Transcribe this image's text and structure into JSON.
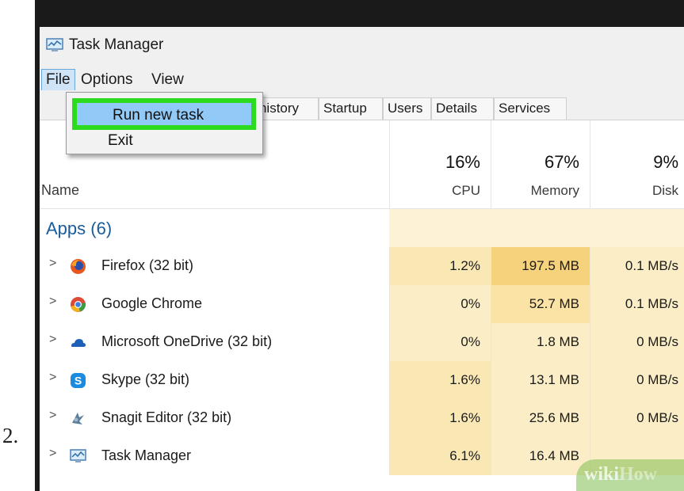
{
  "step_number": "2.",
  "window": {
    "title": "Task Manager"
  },
  "menu": {
    "file": "File",
    "options": "Options",
    "view": "View"
  },
  "file_menu": {
    "run_new_task": "Run new task",
    "exit": "Exit",
    "highlight_color": "#2ddb1e",
    "selection_color": "#91c9f7"
  },
  "tabs": [
    "App history",
    "Startup",
    "Users",
    "Details",
    "Services"
  ],
  "columns": {
    "name": "Name",
    "cpu": {
      "percent": "16%",
      "label": "CPU"
    },
    "memory": {
      "percent": "67%",
      "label": "Memory"
    },
    "disk": {
      "percent": "9%",
      "label": "Disk"
    }
  },
  "group": {
    "label": "Apps (6)"
  },
  "rows": [
    {
      "name": "Firefox (32 bit)",
      "icon": "firefox-icon",
      "cpu": "1.2%",
      "memory": "197.5 MB",
      "disk": "0.1 MB/s"
    },
    {
      "name": "Google Chrome",
      "icon": "chrome-icon",
      "cpu": "0%",
      "memory": "52.7 MB",
      "disk": "0.1 MB/s"
    },
    {
      "name": "Microsoft OneDrive (32 bit)",
      "icon": "onedrive-icon",
      "cpu": "0%",
      "memory": "1.8 MB",
      "disk": "0 MB/s"
    },
    {
      "name": "Skype (32 bit)",
      "icon": "skype-icon",
      "cpu": "1.6%",
      "memory": "13.1 MB",
      "disk": "0 MB/s"
    },
    {
      "name": "Snagit Editor (32 bit)",
      "icon": "snagit-icon",
      "cpu": "1.6%",
      "memory": "25.6 MB",
      "disk": "0 MB/s"
    },
    {
      "name": "Task Manager",
      "icon": "task-manager-icon",
      "cpu": "6.1%",
      "memory": "16.4 MB",
      "disk": ""
    }
  ],
  "watermark": {
    "part1": "wiki",
    "part2": "How"
  },
  "colors": {
    "cpu_cell": "#fae8b4",
    "memory_high": "#f6d27c",
    "memory_cell": "#fae3a4",
    "disk_cell": "#fbeec6",
    "group_text": "#1a5b9a"
  }
}
